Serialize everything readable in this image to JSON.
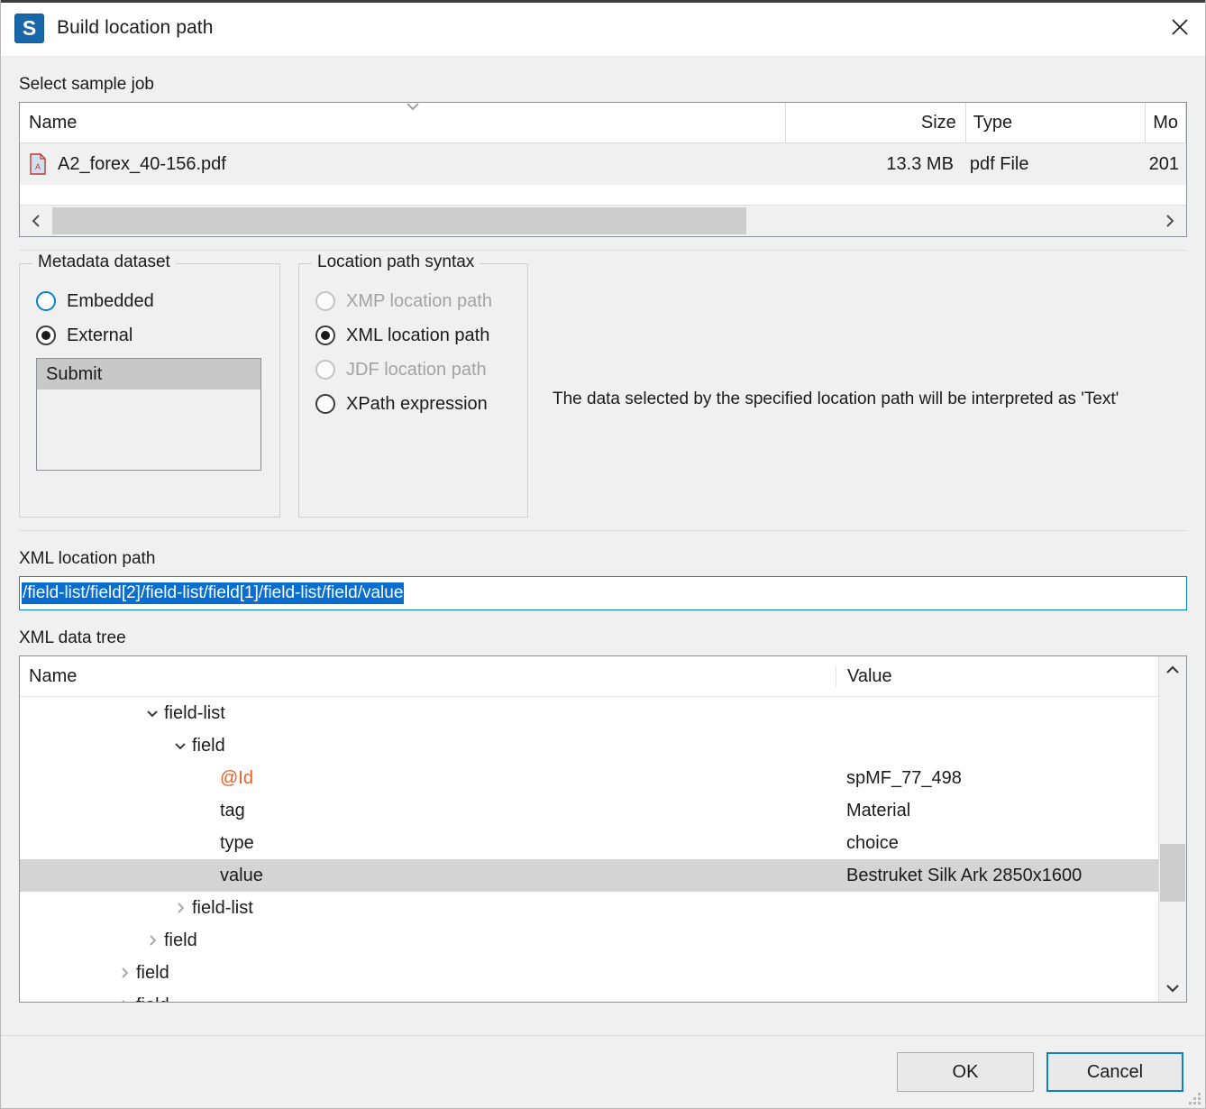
{
  "window": {
    "title": "Build location path",
    "logo_letter": "S",
    "logo_color": "#1867a8",
    "close_icon": "close-icon"
  },
  "sample_job": {
    "label": "Select sample job",
    "columns": [
      "Name",
      "Size",
      "Type",
      "Mo"
    ],
    "rows": [
      {
        "name": "A2_forex_40-156.pdf",
        "size": "13.3 MB",
        "type": "pdf File",
        "modified": "201",
        "icon": "pdf-file-icon",
        "selected": true
      }
    ],
    "sort_indicator": "chevron-down-icon",
    "hscroll": {
      "left_icon": "chevron-left-icon",
      "right_icon": "chevron-right-icon",
      "thumb_percent": 63
    }
  },
  "metadata_dataset": {
    "title": "Metadata dataset",
    "options": [
      {
        "label": "Embedded",
        "checked": false,
        "disabled": false,
        "hover": true
      },
      {
        "label": "External",
        "checked": true,
        "disabled": false,
        "hover": false
      }
    ],
    "listbox": {
      "items": [
        {
          "label": "Submit",
          "selected": true
        }
      ]
    }
  },
  "location_path_syntax": {
    "title": "Location path syntax",
    "options": [
      {
        "label": "XMP location path",
        "checked": false,
        "disabled": true
      },
      {
        "label": "XML location path",
        "checked": true,
        "disabled": false
      },
      {
        "label": "JDF location path",
        "checked": false,
        "disabled": true
      },
      {
        "label": "XPath expression",
        "checked": false,
        "disabled": false
      }
    ],
    "note": "The data selected by the specified location path will be interpreted as 'Text'"
  },
  "xml_location_path": {
    "label": "XML location path",
    "value": "/field-list/field[2]/field-list/field[1]/field-list/field/value",
    "selected": true,
    "selection_color": "#0a6ed1"
  },
  "xml_data_tree": {
    "label": "XML data tree",
    "columns": [
      "Name",
      "Value"
    ],
    "rows": [
      {
        "name": "field-list",
        "value": "",
        "indent": 4,
        "chevron": "chevron-down-icon",
        "selected": false,
        "attribute": false
      },
      {
        "name": "field",
        "value": "",
        "indent": 5,
        "chevron": "chevron-down-icon",
        "selected": false,
        "attribute": false
      },
      {
        "name": "@Id",
        "value": "spMF_77_498",
        "indent": 6,
        "chevron": "",
        "selected": false,
        "attribute": true
      },
      {
        "name": "tag",
        "value": "Material",
        "indent": 6,
        "chevron": "",
        "selected": false,
        "attribute": false
      },
      {
        "name": "type",
        "value": "choice",
        "indent": 6,
        "chevron": "",
        "selected": false,
        "attribute": false
      },
      {
        "name": "value",
        "value": "Bestruket Silk Ark 2850x1600",
        "indent": 6,
        "chevron": "",
        "selected": true,
        "attribute": false
      },
      {
        "name": "field-list",
        "value": "",
        "indent": 5,
        "chevron": "chevron-right-icon",
        "selected": false,
        "attribute": false
      },
      {
        "name": "field",
        "value": "",
        "indent": 4,
        "chevron": "chevron-right-icon",
        "selected": false,
        "attribute": false
      },
      {
        "name": "field",
        "value": "",
        "indent": 3,
        "chevron": "chevron-right-icon",
        "selected": false,
        "attribute": false
      },
      {
        "name": "field",
        "value": "",
        "indent": 3,
        "chevron": "chevron-right-icon",
        "selected": false,
        "attribute": false
      }
    ],
    "vscroll": {
      "up_icon": "chevron-up-icon",
      "down_icon": "chevron-down-icon",
      "thumb_top_percent": 55,
      "thumb_height_percent": 20
    }
  },
  "footer": {
    "ok_label": "OK",
    "cancel_label": "Cancel",
    "default_button": "Cancel",
    "focus_color": "#0a7fd4",
    "resize_grip": "resize-grip-icon"
  }
}
